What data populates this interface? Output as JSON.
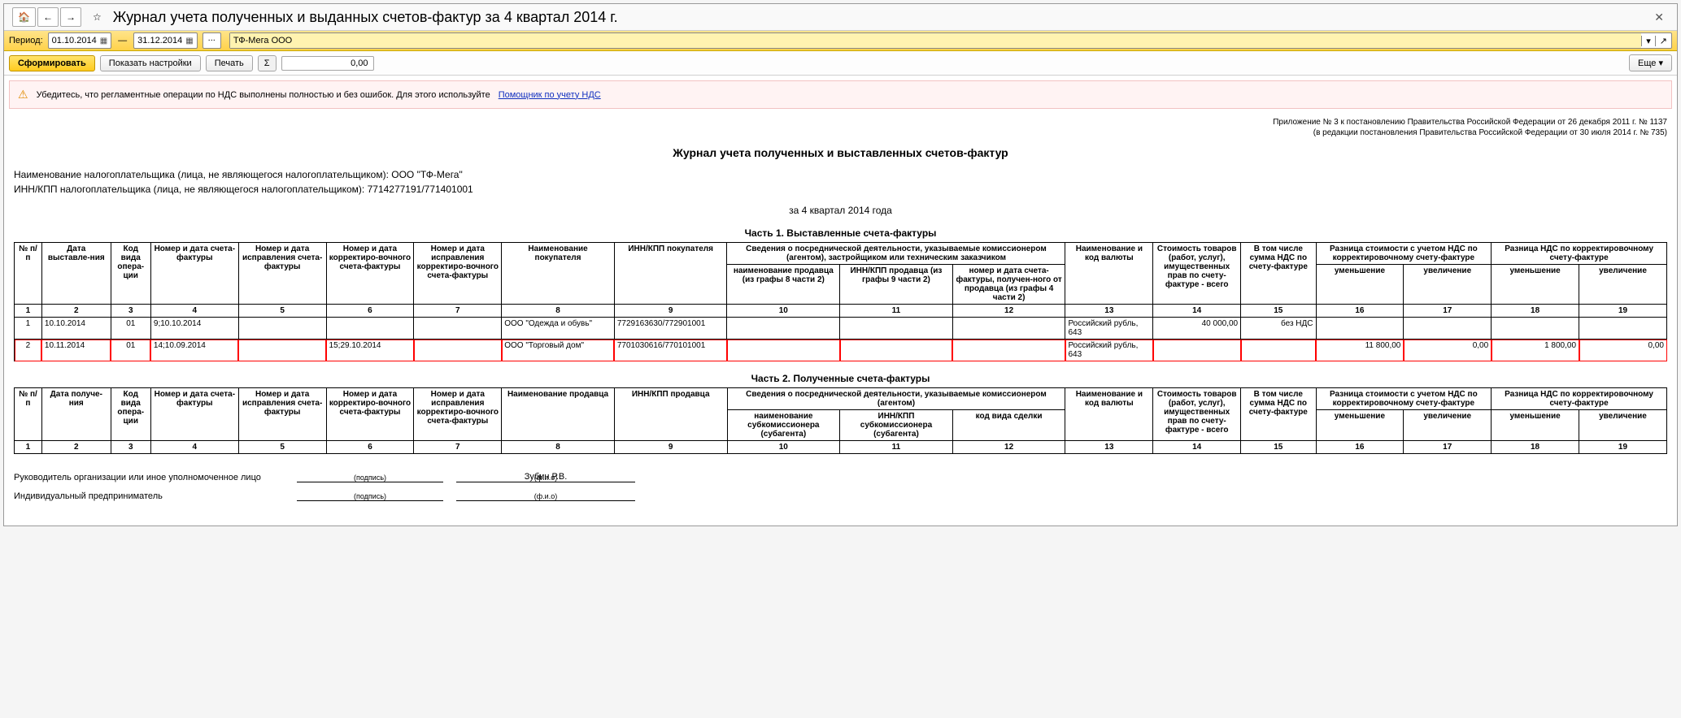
{
  "titlebar": {
    "title": "Журнал учета полученных и выданных счетов-фактур за 4 квартал 2014 г."
  },
  "period": {
    "label": "Период:",
    "from": "01.10.2014",
    "to": "31.12.2014",
    "org": "ТФ-Мега ООО"
  },
  "toolbar": {
    "generate": "Сформировать",
    "show_settings": "Показать настройки",
    "print": "Печать",
    "sigma": "Σ",
    "sum_value": "0,00",
    "more": "Еще"
  },
  "notice": {
    "text": "Убедитесь, что регламентные операции по НДС выполнены полностью и без ошибок. Для этого используйте",
    "link": "Помощник по учету НДС"
  },
  "legal": {
    "line1": "Приложение № 3 к постановлению Правительства Российской Федерации от 26 декабря 2011 г. № 1137",
    "line2": "(в редакции постановления Правительства Российской Федерации от 30 июля 2014 г. № 735)"
  },
  "report": {
    "title": "Журнал учета полученных и выставленных счетов-фактур",
    "taxpayer_name_label": "Наименование налогоплательщика (лица, не являющегося налогоплательщиком): ООО \"ТФ-Мега\"",
    "taxpayer_inn_label": "ИНН/КПП налогоплательщика (лица, не являющегося налогоплательщиком): 7714277191/771401001",
    "period_line": "за 4 квартал 2014 года"
  },
  "part1": {
    "title": "Часть 1. Выставленные счета-фактуры",
    "headers": {
      "c1": "№ п/п",
      "c2": "Дата выставле-ния",
      "c3": "Код вида опера-ции",
      "c4": "Номер и дата счета-фактуры",
      "c5": "Номер и дата исправления счета-фактуры",
      "c6": "Номер и дата корректиро-вочного счета-фактуры",
      "c7": "Номер и дата исправления корректиро-вочного счета-фактуры",
      "c8": "Наименование покупателя",
      "c9": "ИНН/КПП покупателя",
      "c10g": "Сведения о посреднической деятельности, указываемые комиссионером (агентом), застройщиком или техническим заказчиком",
      "c10": "наименование продавца (из графы 8 части 2)",
      "c11": "ИНН/КПП продавца (из графы 9 части 2)",
      "c12": "номер и дата счета-фактуры, получен-ного от продавца (из графы 4 части 2)",
      "c13": "Наименование и код валюты",
      "c14": "Стоимость товаров (работ, услуг), имущественных прав по счету-фактуре - всего",
      "c15": "В том числе сумма НДС по счету-фактуре",
      "c16g": "Разница стоимости с учетом НДС по корректировочному счету-фактуре",
      "c16": "уменьшение",
      "c17": "увеличение",
      "c18g": "Разница НДС по корректировочному счету-фактуре",
      "c18": "уменьшение",
      "c19": "увеличение"
    },
    "nums": [
      "1",
      "2",
      "3",
      "4",
      "5",
      "6",
      "7",
      "8",
      "9",
      "10",
      "11",
      "12",
      "13",
      "14",
      "15",
      "16",
      "17",
      "18",
      "19"
    ],
    "rows": [
      {
        "n": "1",
        "date": "10.10.2014",
        "code": "01",
        "sf": "9;10.10.2014",
        "fix": "",
        "corr": "",
        "fixcorr": "",
        "buyer": "ООО \"Одежда и обувь\"",
        "inn": "7729163630/772901001",
        "s10": "",
        "s11": "",
        "s12": "",
        "cur": "Российский рубль, 643",
        "cost": "40 000,00",
        "vat": "без НДС",
        "d16": "",
        "d17": "",
        "d18": "",
        "d19": "",
        "hl": false
      },
      {
        "n": "2",
        "date": "10.11.2014",
        "code": "01",
        "sf": "14;10.09.2014",
        "fix": "",
        "corr": "15;29.10.2014",
        "fixcorr": "",
        "buyer": "ООО \"Торговый дом\"",
        "inn": "7701030616/770101001",
        "s10": "",
        "s11": "",
        "s12": "",
        "cur": "Российский рубль, 643",
        "cost": "",
        "vat": "",
        "d16": "11 800,00",
        "d17": "0,00",
        "d18": "1 800,00",
        "d19": "0,00",
        "hl": true
      }
    ]
  },
  "part2": {
    "title": "Часть 2. Полученные счета-фактуры",
    "headers": {
      "c1": "№ п/п",
      "c2": "Дата получе-ния",
      "c3": "Код вида опера-ции",
      "c4": "Номер и дата счета-фактуры",
      "c5": "Номер и дата исправления счета-фактуры",
      "c6": "Номер и дата корректиро-вочного счета-фактуры",
      "c7": "Номер и дата исправления корректиро-вочного счета-фактуры",
      "c8": "Наименование продавца",
      "c9": "ИНН/КПП продавца",
      "c10g": "Сведения о посреднической деятельности, указываемые комиссионером (агентом)",
      "c10": "наименование субкомиссионера (субагента)",
      "c11": "ИНН/КПП субкомиссионера (субагента)",
      "c12": "код вида сделки",
      "c13": "Наименование и код валюты",
      "c14": "Стоимость товаров (работ, услуг), имущественных прав по счету-фактуре - всего",
      "c15": "В том числе сумма НДС по счету-фактуре",
      "c16g": "Разница стоимости с учетом НДС по корректировочному счету-фактуре",
      "c16": "уменьшение",
      "c17": "увеличение",
      "c18g": "Разница НДС по корректировочному счету-фактуре",
      "c18": "уменьшение",
      "c19": "увеличение"
    },
    "nums": [
      "1",
      "2",
      "3",
      "4",
      "5",
      "6",
      "7",
      "8",
      "9",
      "10",
      "11",
      "12",
      "13",
      "14",
      "15",
      "16",
      "17",
      "18",
      "19"
    ]
  },
  "sign": {
    "head_label": "Руководитель организации или иное уполномоченное лицо",
    "ip_label": "Индивидуальный предприниматель",
    "signature_cap": "(подпись)",
    "fio_cap": "(ф.и.о)",
    "head_fio": "Зубин Р.В."
  }
}
